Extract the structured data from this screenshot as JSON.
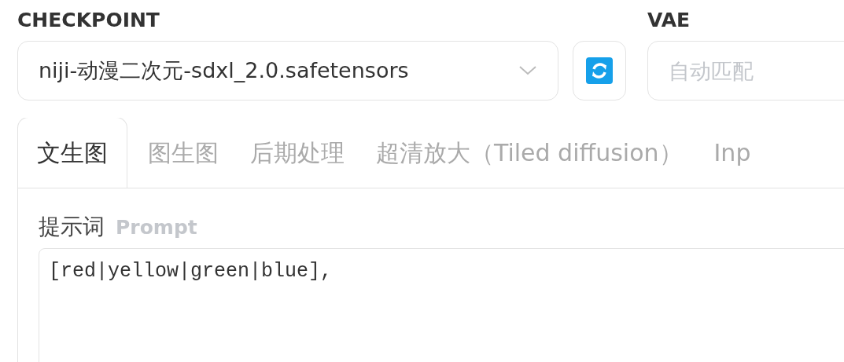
{
  "checkpoint": {
    "label": "CHECKPOINT",
    "value": "niji-动漫二次元-sdxl_2.0.safetensors"
  },
  "vae": {
    "label": "VAE",
    "placeholder": "自动匹配"
  },
  "tabs": [
    {
      "label": "文生图",
      "selected": true
    },
    {
      "label": "图生图",
      "selected": false
    },
    {
      "label": "后期处理",
      "selected": false
    },
    {
      "label": "超清放大（Tiled diffusion）",
      "selected": false
    },
    {
      "label": "Inp",
      "selected": false
    }
  ],
  "prompt": {
    "label": "提示词",
    "hint": "Prompt",
    "value": "[red|yellow|green|blue],"
  }
}
